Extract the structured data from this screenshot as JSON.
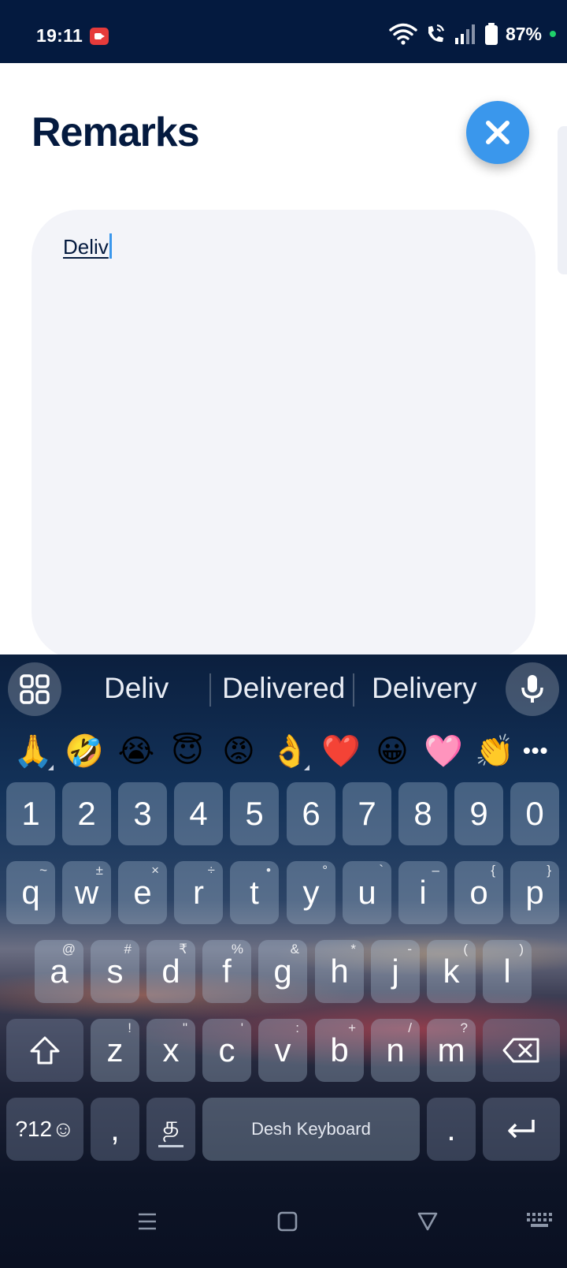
{
  "status_bar": {
    "time": "19:11",
    "battery": "87%"
  },
  "header": {
    "title": "Remarks"
  },
  "remarks": {
    "value": "Deliv"
  },
  "keyboard": {
    "suggestions": [
      "Deliv",
      "Delivered",
      "Delivery"
    ],
    "emojis": [
      "🙏",
      "🤣",
      "😭",
      "😇",
      "😡",
      "👌",
      "❤️",
      "😀",
      "🩷",
      "👏"
    ],
    "emoji_more": "•••",
    "number_row": [
      "1",
      "2",
      "3",
      "4",
      "5",
      "6",
      "7",
      "8",
      "9",
      "0"
    ],
    "row1": [
      {
        "key": "q",
        "hint": "~"
      },
      {
        "key": "w",
        "hint": "±"
      },
      {
        "key": "e",
        "hint": "×"
      },
      {
        "key": "r",
        "hint": "÷"
      },
      {
        "key": "t",
        "hint": "•"
      },
      {
        "key": "y",
        "hint": "°"
      },
      {
        "key": "u",
        "hint": "`"
      },
      {
        "key": "i",
        "hint": "–"
      },
      {
        "key": "o",
        "hint": "{"
      },
      {
        "key": "p",
        "hint": "}"
      }
    ],
    "row2": [
      {
        "key": "a",
        "hint": "@"
      },
      {
        "key": "s",
        "hint": "#"
      },
      {
        "key": "d",
        "hint": "₹"
      },
      {
        "key": "f",
        "hint": "%"
      },
      {
        "key": "g",
        "hint": "&"
      },
      {
        "key": "h",
        "hint": "*"
      },
      {
        "key": "j",
        "hint": "-"
      },
      {
        "key": "k",
        "hint": "("
      },
      {
        "key": "l",
        "hint": ")"
      }
    ],
    "row3": [
      {
        "key": "z",
        "hint": "!"
      },
      {
        "key": "x",
        "hint": "\""
      },
      {
        "key": "c",
        "hint": "'"
      },
      {
        "key": "v",
        "hint": ":"
      },
      {
        "key": "b",
        "hint": "+"
      },
      {
        "key": "n",
        "hint": "/"
      },
      {
        "key": "m",
        "hint": "?"
      }
    ],
    "symbols_key": "?12☺",
    "comma_key": ",",
    "language_key": "த",
    "space_key": "Desh Keyboard",
    "period_key": ".",
    "accent_color": "#3a97ec"
  }
}
